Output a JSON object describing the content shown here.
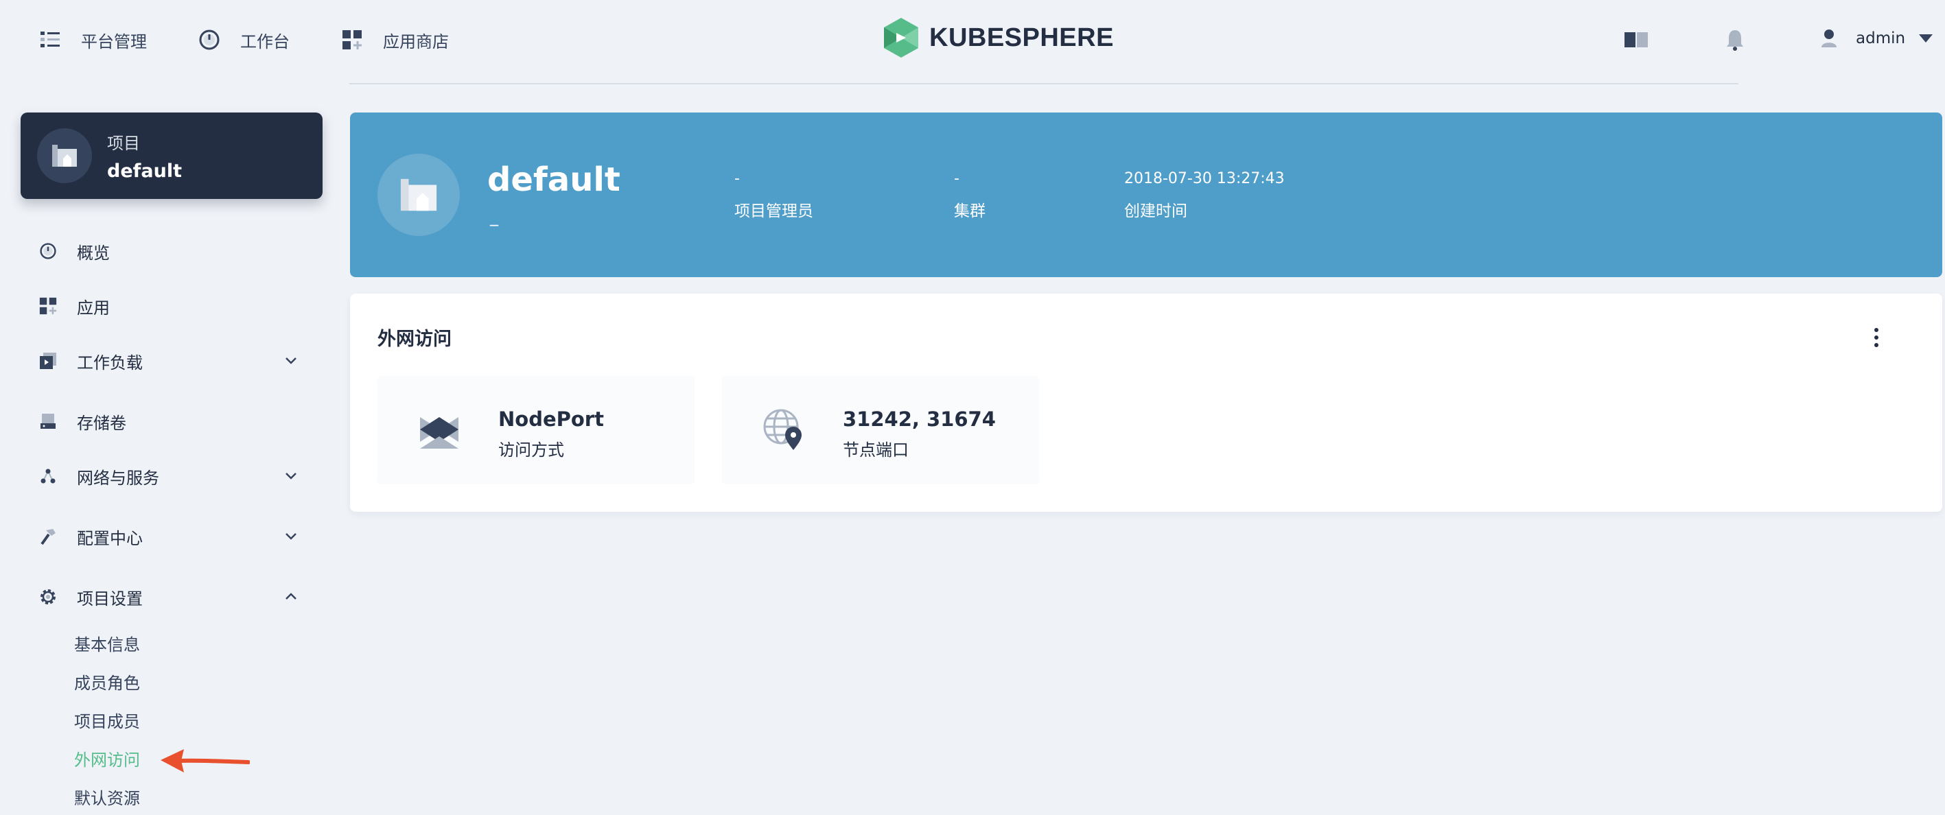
{
  "topnav": {
    "items": [
      {
        "label": "平台管理",
        "icon": "list-icon"
      },
      {
        "label": "工作台",
        "icon": "dashboard-icon"
      },
      {
        "label": "应用商店",
        "icon": "apps-icon"
      }
    ],
    "logo_text": "KUBESPHERE",
    "user": "admin"
  },
  "sidebar": {
    "project": {
      "label": "项目",
      "name": "default"
    },
    "items": [
      {
        "label": "概览",
        "icon": "dashboard-icon"
      },
      {
        "label": "应用",
        "icon": "apps-icon"
      },
      {
        "label": "工作负载",
        "icon": "workload-icon",
        "expandable": true
      },
      {
        "label": "存储卷",
        "icon": "storage-icon"
      },
      {
        "label": "网络与服务",
        "icon": "network-icon",
        "expandable": true
      },
      {
        "label": "配置中心",
        "icon": "hammer-icon",
        "expandable": true
      },
      {
        "label": "项目设置",
        "icon": "gear-icon",
        "expanded": true
      }
    ],
    "sub_items": [
      "基本信息",
      "成员角色",
      "项目成员",
      "外网访问",
      "默认资源"
    ],
    "active_sub": "外网访问"
  },
  "banner": {
    "title": "default",
    "subtitle": "_",
    "meta": [
      {
        "value": "-",
        "label": "项目管理员"
      },
      {
        "value": "-",
        "label": "集群"
      },
      {
        "value": "2018-07-30 13:27:43",
        "label": "创建时间"
      }
    ]
  },
  "card": {
    "title": "外网访问",
    "stats": [
      {
        "value": "NodePort",
        "label": "访问方式",
        "icon": "nodeport-icon"
      },
      {
        "value": "31242, 31674",
        "label": "节点端口",
        "icon": "globe-pin-icon"
      }
    ]
  },
  "colors": {
    "banner": "#4f9dc9",
    "project_card": "#242e42",
    "active": "#55bc8a",
    "annotation_arrow": "#e8502e"
  }
}
